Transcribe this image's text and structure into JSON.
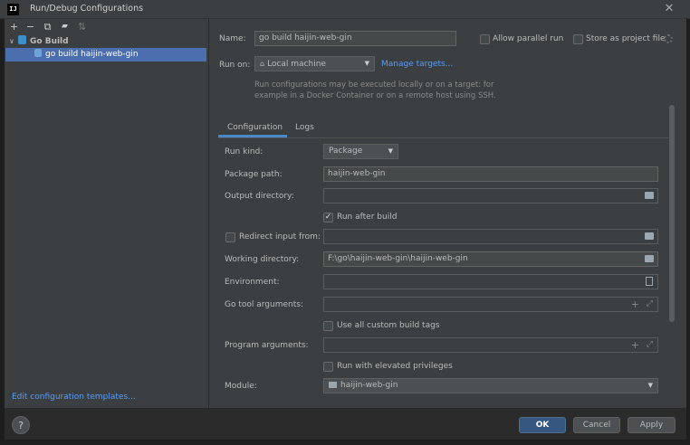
{
  "window": {
    "title": "Run/Debug Configurations",
    "app_icon_text": "IJ"
  },
  "toolbar": {
    "add": "+",
    "remove": "−",
    "copy": "⧉",
    "folder": "▰",
    "sort": "⇅"
  },
  "tree": {
    "group_label": "Go Build",
    "item_label": "go build haijin-web-gin"
  },
  "left": {
    "edit_templates_link": "Edit configuration templates..."
  },
  "form": {
    "name_label": "Name:",
    "name_value": "go build haijin-web-gin",
    "allow_parallel_label": "Allow parallel run",
    "store_as_project_label": "Store as project file",
    "run_on_label": "Run on:",
    "run_on_value": "Local machine",
    "manage_targets_link": "Manage targets...",
    "run_on_hint_line1": "Run configurations may be executed locally or on a target: for",
    "run_on_hint_line2": "example in a Docker Container or on a remote host using SSH.",
    "tabs": [
      {
        "label": "Configuration"
      },
      {
        "label": "Logs"
      }
    ],
    "run_kind_label": "Run kind:",
    "run_kind_value": "Package",
    "package_path_label": "Package path:",
    "package_path_value": "haijin-web-gin",
    "output_dir_label": "Output directory:",
    "output_dir_value": "",
    "run_after_build_label": "Run after build",
    "run_after_build_checked": true,
    "redirect_input_label": "Redirect input from:",
    "redirect_input_value": "",
    "working_dir_label": "Working directory:",
    "working_dir_value": "F:\\go\\haijin-web-gin\\haijin-web-gin",
    "environment_label": "Environment:",
    "environment_value": "",
    "go_tool_args_label": "Go tool arguments:",
    "go_tool_args_value": "",
    "custom_build_tags_label": "Use all custom build tags",
    "program_args_label": "Program arguments:",
    "program_args_value": "",
    "elevated_label": "Run with elevated privileges",
    "module_label": "Module:",
    "module_value": "haijin-web-gin"
  },
  "buttons": {
    "ok": "OK",
    "cancel": "Cancel",
    "apply": "Apply",
    "help": "?"
  },
  "colors": {
    "accent": "#4b6eaf",
    "link": "#589df6",
    "primary_button": "#365880",
    "background": "#3c3f41"
  }
}
